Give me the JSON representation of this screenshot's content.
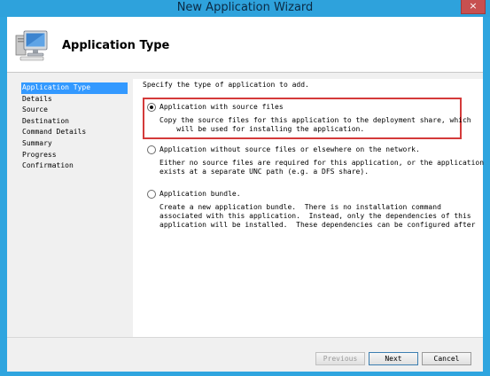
{
  "window": {
    "title": "New Application Wizard",
    "close_glyph": "×"
  },
  "header": {
    "title": "Application Type",
    "icon": "computer-monitor-icon"
  },
  "nav": {
    "items": [
      {
        "label": "Application Type"
      },
      {
        "label": "Details"
      },
      {
        "label": "Source"
      },
      {
        "label": "Destination"
      },
      {
        "label": "Command Details"
      },
      {
        "label": "Summary"
      },
      {
        "label": "Progress"
      },
      {
        "label": "Confirmation"
      }
    ]
  },
  "content": {
    "prompt": "Specify the type of application to add.",
    "options": [
      {
        "label": "Application with source files",
        "selected": true,
        "description": "Copy the source files for this application to the deployment share, which\n    will be used for installing the application."
      },
      {
        "label": "Application without source files or elsewhere on the network.",
        "selected": false,
        "description": "Either no source files are required for this application, or the application\nexists at a separate UNC path (e.g. a DFS share)."
      },
      {
        "label": "Application bundle.",
        "selected": false,
        "description": "Create a new application bundle.  There is no installation command\nassociated with this application.  Instead, only the dependencies of this\napplication will be installed.  These dependencies can be configured after"
      }
    ]
  },
  "footer": {
    "previous_label": "Previous",
    "next_label": "Next",
    "cancel_label": "Cancel"
  },
  "colors": {
    "titlebar": "#2ea2dc",
    "selection": "#3399ff",
    "highlight_border": "#d43a3a",
    "close": "#c75050"
  }
}
